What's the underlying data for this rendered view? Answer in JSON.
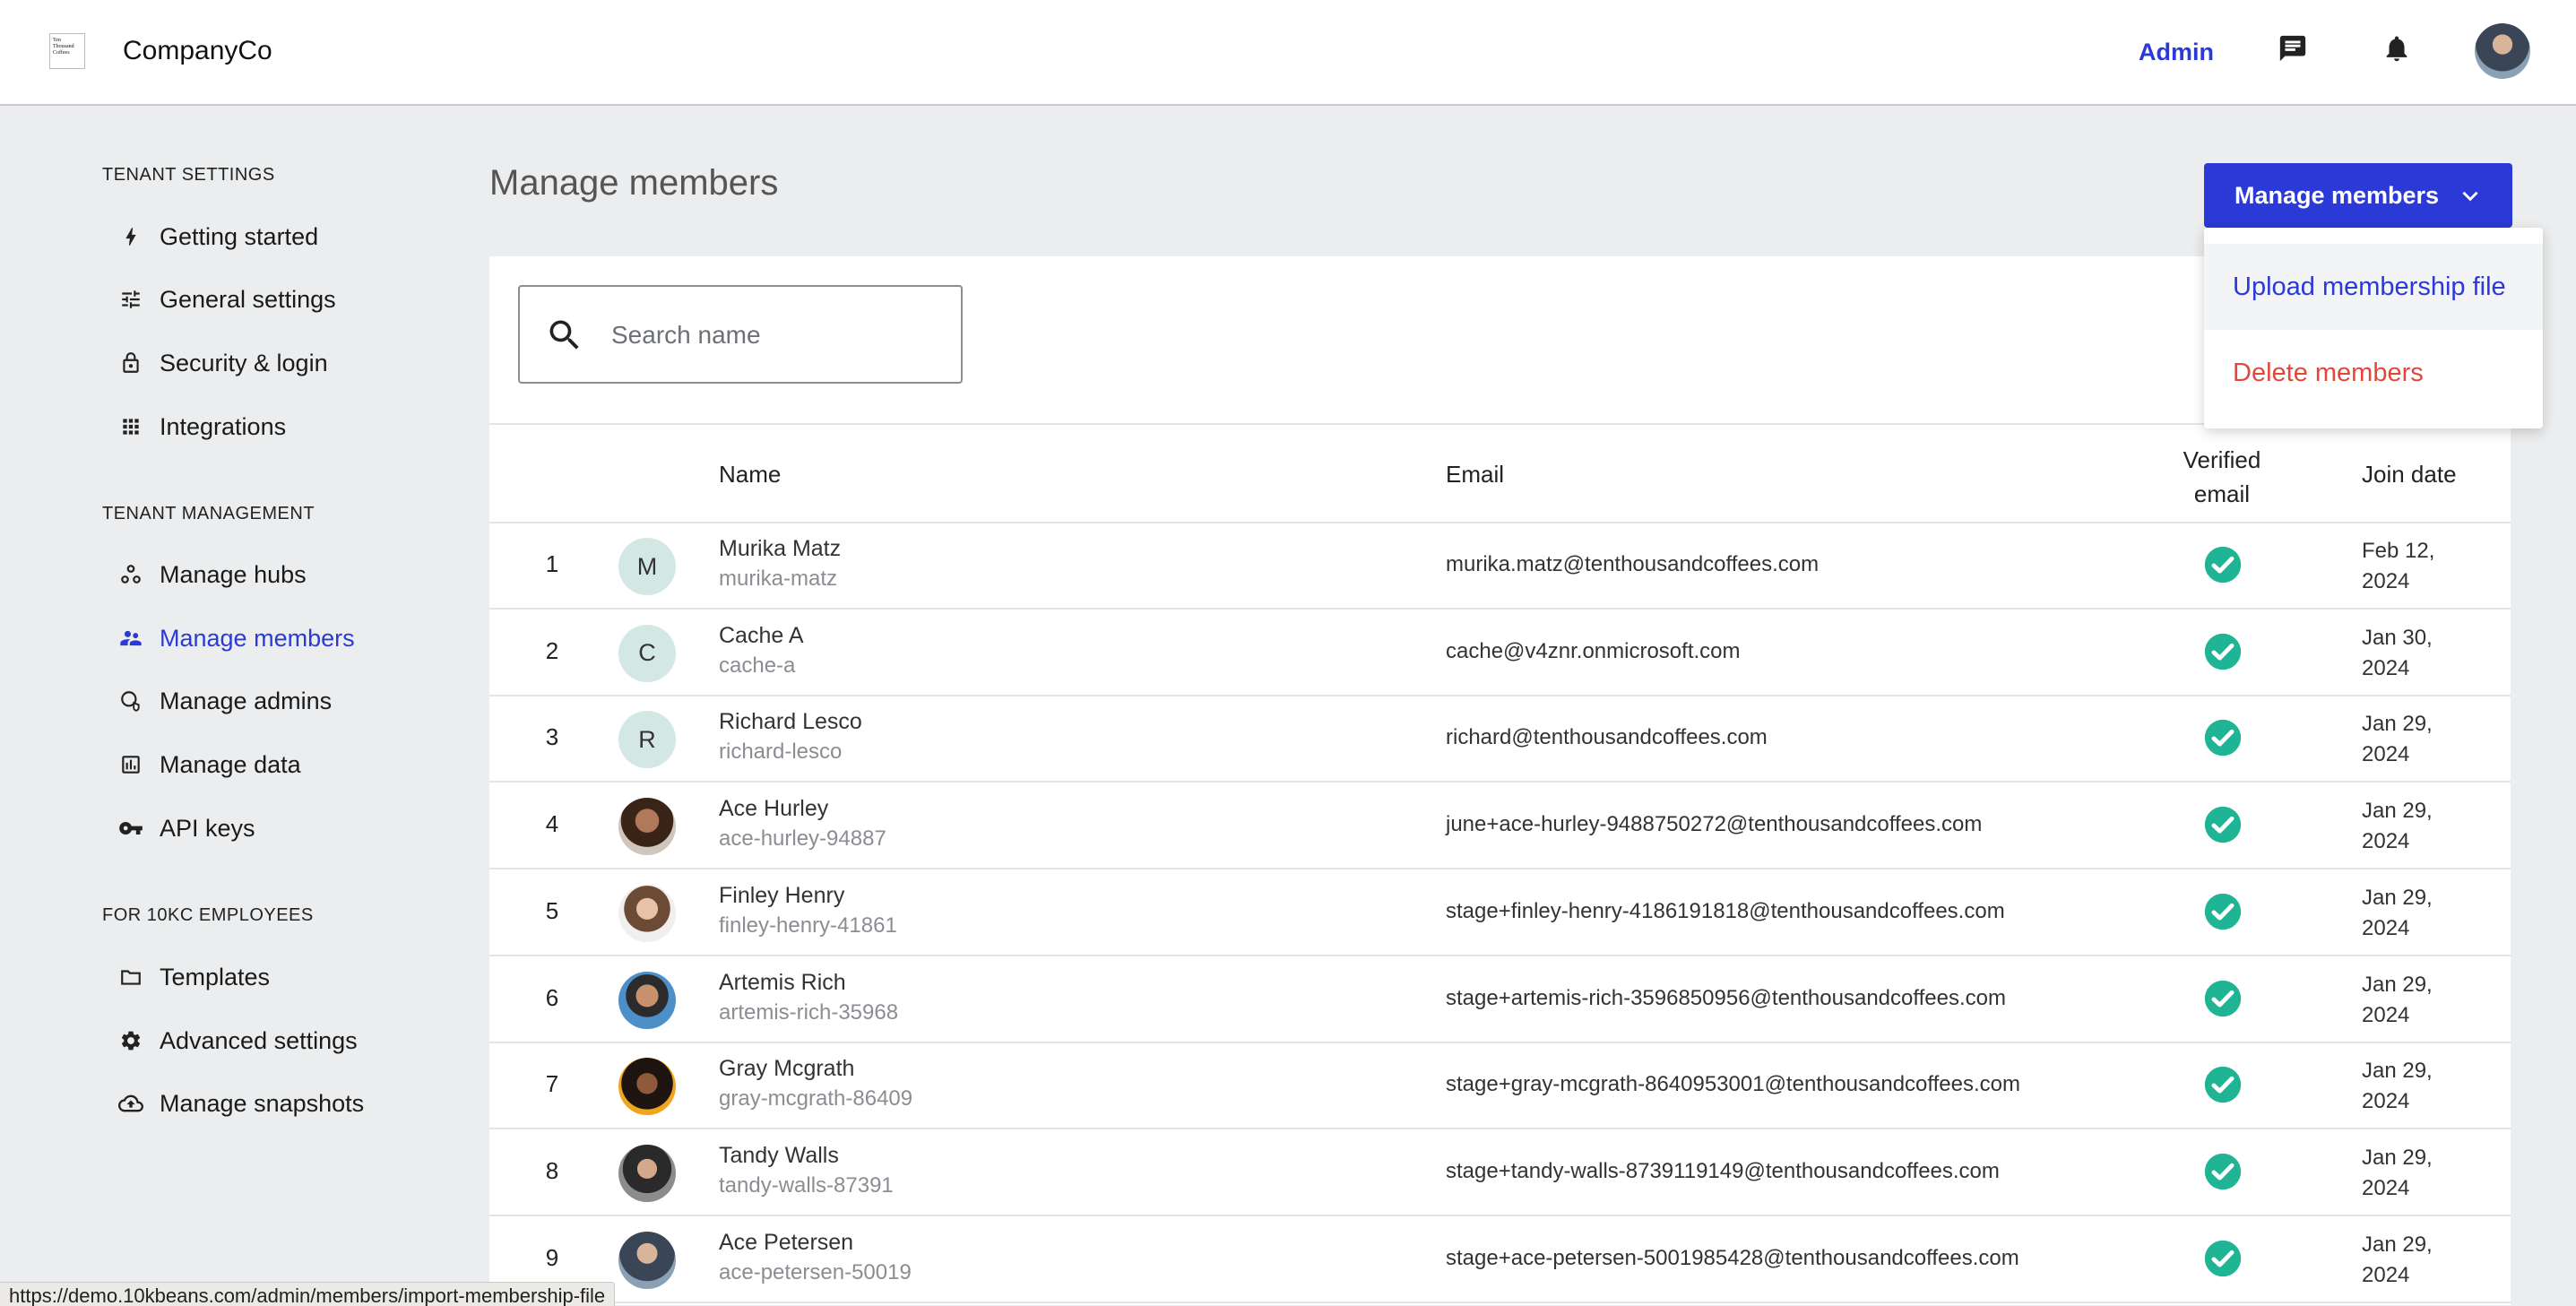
{
  "header": {
    "logo_text": "Ten Thousand Coffees",
    "company": "CompanyCo",
    "admin_link": "Admin"
  },
  "sidebar": {
    "sections": [
      {
        "title": "TENANT SETTINGS",
        "items": [
          {
            "label": "Getting started",
            "icon": "bolt-icon"
          },
          {
            "label": "General settings",
            "icon": "sliders-icon"
          },
          {
            "label": "Security & login",
            "icon": "lock-icon"
          },
          {
            "label": "Integrations",
            "icon": "grid-icon"
          }
        ]
      },
      {
        "title": "TENANT MANAGEMENT",
        "items": [
          {
            "label": "Manage hubs",
            "icon": "hubs-icon"
          },
          {
            "label": "Manage members",
            "icon": "people-icon",
            "active": true
          },
          {
            "label": "Manage admins",
            "icon": "admin-shield-icon"
          },
          {
            "label": "Manage data",
            "icon": "bar-chart-icon"
          },
          {
            "label": "API keys",
            "icon": "key-icon"
          }
        ]
      },
      {
        "title": "FOR 10KC EMPLOYEES",
        "items": [
          {
            "label": "Templates",
            "icon": "folder-icon"
          },
          {
            "label": "Advanced settings",
            "icon": "gear-icon"
          },
          {
            "label": "Manage snapshots",
            "icon": "cloud-upload-icon"
          }
        ]
      }
    ]
  },
  "main": {
    "title": "Manage members",
    "action_button": "Manage members",
    "dropdown": {
      "upload": "Upload membership file",
      "delete": "Delete members"
    },
    "search": {
      "placeholder": "Search name"
    },
    "columns": {
      "name": "Name",
      "email": "Email",
      "verified": "Verified email",
      "join": "Join date"
    },
    "rows": [
      {
        "n": "1",
        "name": "Murika Matz",
        "handle": "murika-matz",
        "email": "murika.matz@tenthousandcoffees.com",
        "join": "Feb 12, 2024",
        "initial": "M"
      },
      {
        "n": "2",
        "name": "Cache A",
        "handle": "cache-a",
        "email": "cache@v4znr.onmicrosoft.com",
        "join": "Jan 30, 2024",
        "initial": "C"
      },
      {
        "n": "3",
        "name": "Richard Lesco",
        "handle": "richard-lesco",
        "email": "richard@tenthousandcoffees.com",
        "join": "Jan 29, 2024",
        "initial": "R"
      },
      {
        "n": "4",
        "name": "Ace Hurley",
        "handle": "ace-hurley-94887",
        "email": "june+ace-hurley-9488750272@tenthousandcoffees.com",
        "join": "Jan 29, 2024",
        "initial": ""
      },
      {
        "n": "5",
        "name": "Finley Henry",
        "handle": "finley-henry-41861",
        "email": "stage+finley-henry-4186191818@tenthousandcoffees.com",
        "join": "Jan 29, 2024",
        "initial": ""
      },
      {
        "n": "6",
        "name": "Artemis Rich",
        "handle": "artemis-rich-35968",
        "email": "stage+artemis-rich-3596850956@tenthousandcoffees.com",
        "join": "Jan 29, 2024",
        "initial": ""
      },
      {
        "n": "7",
        "name": "Gray Mcgrath",
        "handle": "gray-mcgrath-86409",
        "email": "stage+gray-mcgrath-8640953001@tenthousandcoffees.com",
        "join": "Jan 29, 2024",
        "initial": ""
      },
      {
        "n": "8",
        "name": "Tandy Walls",
        "handle": "tandy-walls-87391",
        "email": "stage+tandy-walls-8739119149@tenthousandcoffees.com",
        "join": "Jan 29, 2024",
        "initial": ""
      },
      {
        "n": "9",
        "name": "Ace Petersen",
        "handle": "ace-petersen-50019",
        "email": "stage+ace-petersen-5001985428@tenthousandcoffees.com",
        "join": "Jan 29, 2024",
        "initial": ""
      }
    ]
  },
  "status_bar": {
    "url": "https://demo.10kbeans.com/admin/members/import-membership-file"
  },
  "colors": {
    "accent": "#2b39d6",
    "danger": "#e2483a",
    "verified": "#1fb493"
  }
}
